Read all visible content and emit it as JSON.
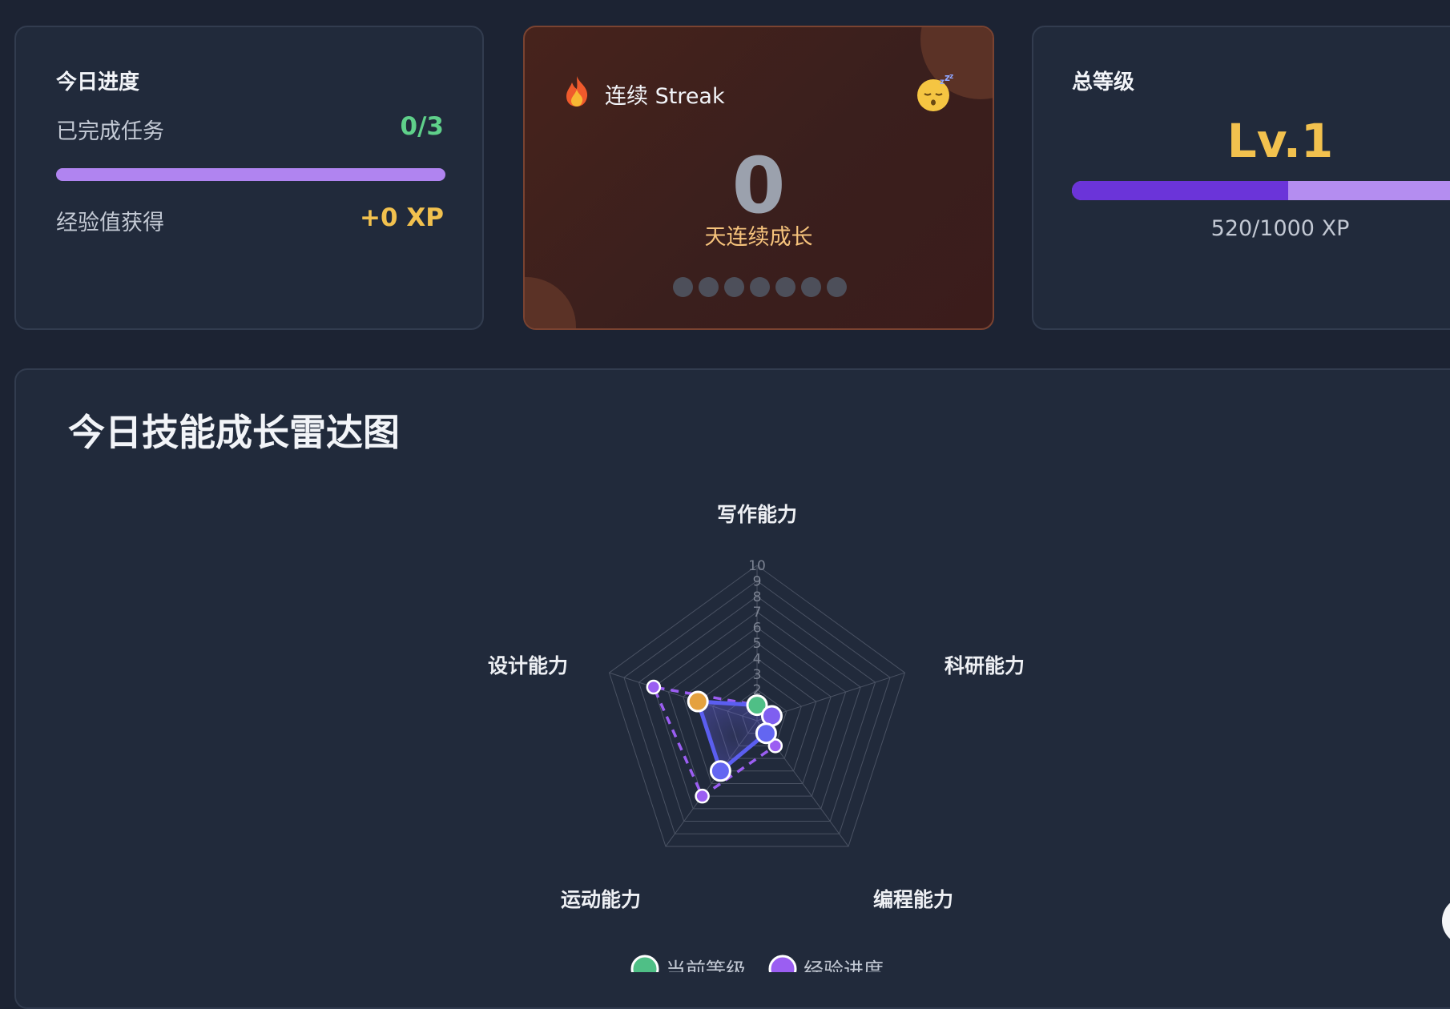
{
  "progress_card": {
    "title": "今日进度",
    "tasks_label": "已完成任务",
    "tasks_value": "0/3",
    "xp_label": "经验值获得",
    "xp_value": "+0 XP",
    "colors": {
      "tasks_value": "#5fd08a",
      "xp_value": "#f2c14e",
      "bar": "#b084f0"
    }
  },
  "streak_card": {
    "fire_icon": "fire-icon",
    "title": "连续 Streak",
    "status_icon": "sleeping-face-icon",
    "count": "0",
    "subtitle": "天连续成长",
    "day_dots": 7,
    "colors": {
      "count": "#9ba1ad",
      "subtitle": "#f6c37c"
    }
  },
  "level_card": {
    "title": "总等级",
    "level": "Lv.1",
    "xp_text": "520/1000 XP",
    "xp_current": 520,
    "xp_max": 1000,
    "colors": {
      "level": "#f2c14e",
      "fill": "#6b34d9",
      "track": "#b48df0"
    }
  },
  "radar_card": {
    "title": "今日技能成长雷达图"
  },
  "chart_data": {
    "type": "radar",
    "title": "今日技能成长雷达图",
    "axes": [
      "写作能力",
      "科研能力",
      "编程能力",
      "运动能力",
      "设计能力"
    ],
    "scale": {
      "min": 0,
      "max": 10,
      "ticks": [
        "1",
        "2",
        "3",
        "4",
        "5",
        "6",
        "7",
        "8",
        "9",
        "10"
      ]
    },
    "series": [
      {
        "name": "当前等级",
        "values": [
          1,
          1,
          1,
          4,
          4
        ],
        "style": "solid",
        "color": "#5b5ef0",
        "point_colors": [
          "#4fbf86",
          "#7f5ff0",
          "#6366f1",
          "#6366f1",
          "#e5a13f"
        ]
      },
      {
        "name": "经验进度",
        "values": [
          1,
          1,
          2,
          6,
          7
        ],
        "style": "dashed",
        "color": "#9b5ef2",
        "point_colors": [
          "#9b5ef2",
          "#9b5ef2",
          "#9b5ef2",
          "#9b5ef2",
          "#9b5ef2"
        ]
      }
    ],
    "legend": {
      "placement": "bottom",
      "items": [
        "当前等级",
        "经验进度"
      ],
      "colors": [
        "#4fbf86",
        "#9b5ef2"
      ]
    }
  }
}
